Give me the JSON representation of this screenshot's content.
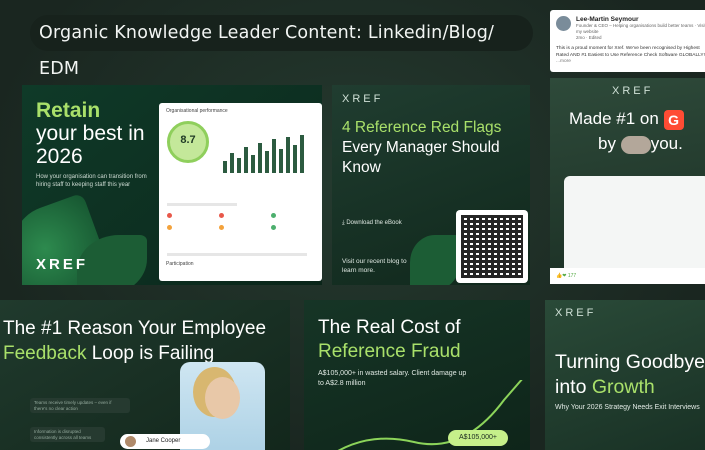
{
  "title": "Organic Knowledge Leader Content: Linkedin/Blog/ EDM",
  "card1": {
    "head_green": "Retain",
    "head_white": "your best in 2026",
    "sub": "How your organisation can transition from hiring staff to keeping staff this year",
    "logo": "XREF",
    "dash_title": "Organisational performance",
    "score": "8.7",
    "section": "Participation"
  },
  "card2": {
    "logo": "XREF",
    "head_green": "4 Reference Red Flags",
    "head_white": "Every Manager Should Know",
    "button": "Download the eBook",
    "sub": "Visit our recent blog to learn more."
  },
  "card3": {
    "name": "Lee-Martin Seymour",
    "meta": "Founder & CEO – Helping organisations build better teams · Visit my website",
    "time": "2mo · Edited",
    "text": "This is a proud moment for Xref. We've been recognised by Highest Rated AND #1 Easiest to Use Reference Check Software GLOBALLY!",
    "more": "...more"
  },
  "card4": {
    "logo": "XREF",
    "line1": "Made #1 on",
    "g2": "G",
    "line2_tail": "you.",
    "by": "by",
    "reactions": "177"
  },
  "card5": {
    "head_white1": "The #1 Reason Your Employee",
    "head_green": "Feedback",
    "head_white2": "Loop is Failing",
    "bubble1": "Teams receive timely updates – even if there's no clear action",
    "bubble2": "Information is disrupted consistently across all teams",
    "person": "Jane Cooper"
  },
  "card6": {
    "head_white": "The Real Cost of",
    "head_green": "Reference Fraud",
    "sub": "A$105,000+ in wasted salary. Client damage up to A$2.8 million",
    "pill": "A$105,000+"
  },
  "card7": {
    "logo": "XREF",
    "head_white": "Turning Goodbye",
    "head_white2": "into",
    "head_green": "Growth",
    "sub": "Why Your 2026 Strategy Needs Exit Interviews"
  }
}
